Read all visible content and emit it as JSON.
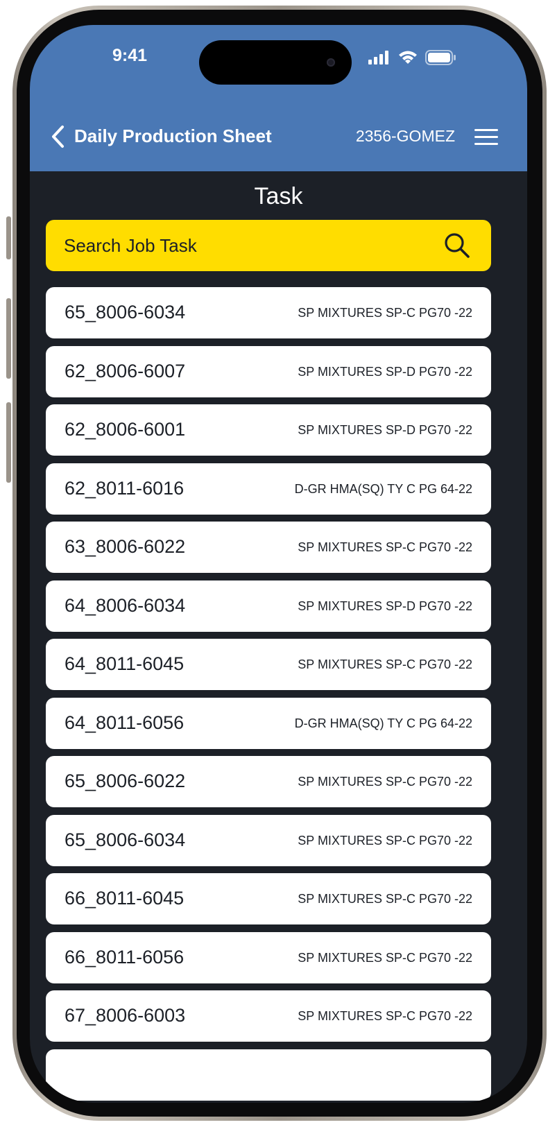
{
  "status_bar": {
    "time": "9:41"
  },
  "header": {
    "title": "Daily Production Sheet",
    "job_code": "2356-GOMEZ",
    "background_color": "#4a78b5",
    "back_icon": "chevron-left-icon",
    "menu_icon": "hamburger-menu-icon"
  },
  "main": {
    "section_title": "Task",
    "search": {
      "placeholder": "Search Job Task",
      "icon": "search-icon",
      "background_color": "#ffdd00"
    },
    "tasks": [
      {
        "code": "65_8006-6034",
        "description": "SP MIXTURES SP-C PG70 -22"
      },
      {
        "code": "62_8006-6007",
        "description": "SP MIXTURES SP-D PG70 -22"
      },
      {
        "code": "62_8006-6001",
        "description": "SP MIXTURES SP-D PG70 -22"
      },
      {
        "code": "62_8011-6016",
        "description": "D-GR HMA(SQ) TY C PG 64-22"
      },
      {
        "code": "63_8006-6022",
        "description": "SP MIXTURES SP-C PG70 -22"
      },
      {
        "code": "64_8006-6034",
        "description": "SP MIXTURES SP-D PG70 -22"
      },
      {
        "code": "64_8011-6045",
        "description": "SP MIXTURES SP-C PG70 -22"
      },
      {
        "code": "64_8011-6056",
        "description": "D-GR HMA(SQ) TY C PG 64-22"
      },
      {
        "code": "65_8006-6022",
        "description": "SP MIXTURES SP-C PG70 -22"
      },
      {
        "code": "65_8006-6034",
        "description": "SP MIXTURES SP-C PG70 -22"
      },
      {
        "code": "66_8011-6045",
        "description": "SP MIXTURES SP-C PG70 -22"
      },
      {
        "code": "66_8011-6056",
        "description": "SP MIXTURES SP-C PG70 -22"
      },
      {
        "code": "67_8006-6003",
        "description": "SP MIXTURES SP-C PG70 -22"
      }
    ],
    "background_color": "#1c2027"
  }
}
